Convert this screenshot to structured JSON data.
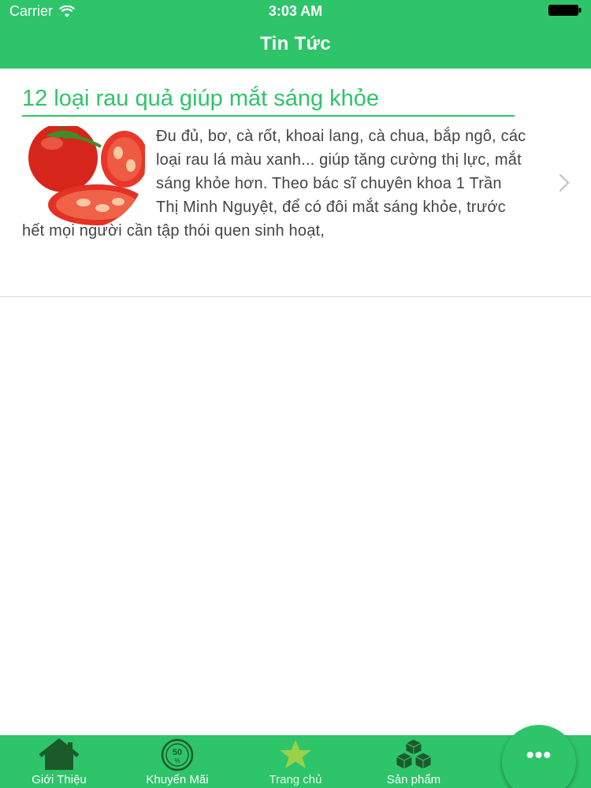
{
  "status_bar": {
    "carrier": "Carrier",
    "time": "3:03 AM",
    "icons": [
      "wifi-icon",
      "battery-icon"
    ]
  },
  "nav": {
    "title": "Tin Tức"
  },
  "news": [
    {
      "title": "12 loại rau quả giúp mắt sáng khỏe",
      "excerpt": "Đu đủ, bơ, cà rốt, khoai lang, cà chua, bắp ngô, các loại rau lá màu xanh... giúp tăng cường thị lực, mắt sáng khỏe hơn. Theo bác sĩ chuyên khoa 1 Trần Thị Minh Nguyệt, để có đôi mắt sáng khỏe, trước hết mọi người cần tập thói quen sinh hoạt,",
      "thumbnail": "tomato-image"
    }
  ],
  "tabs": [
    {
      "label": "Giới Thiệu",
      "icon": "home-icon"
    },
    {
      "label": "Khuyến Mãi",
      "icon": "discount-badge-icon"
    },
    {
      "label": "Trang chủ",
      "icon": "star-icon"
    },
    {
      "label": "Sản phẩm",
      "icon": "boxes-icon"
    }
  ],
  "fab": {
    "label": "•••",
    "icon": "more-icon"
  },
  "colors": {
    "accent": "#2ec46a",
    "text": "#444444",
    "star": "#9bd14a"
  }
}
